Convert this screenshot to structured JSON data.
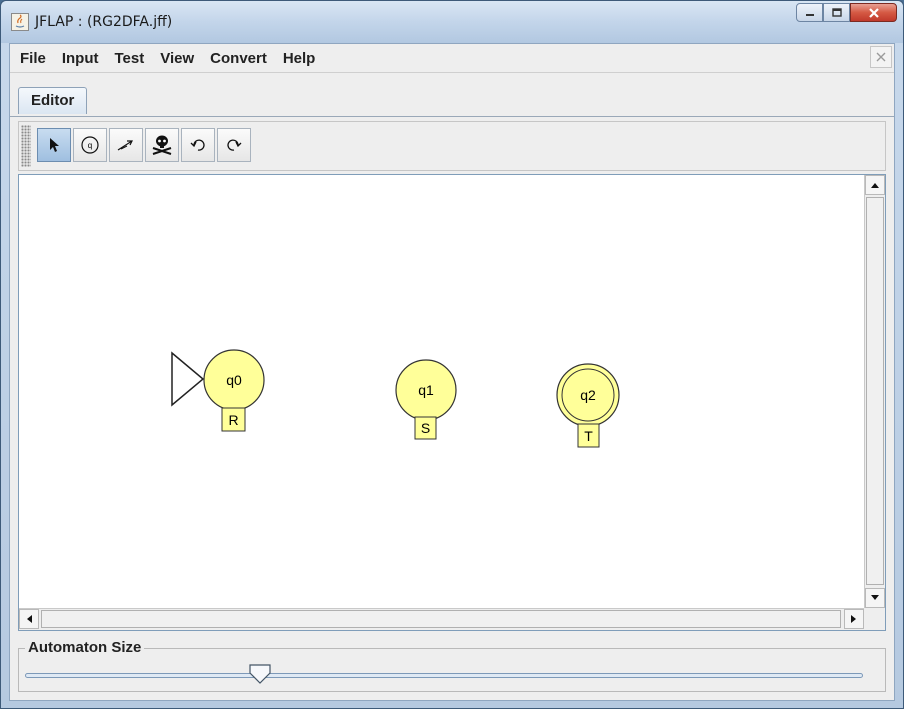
{
  "window": {
    "title": "JFLAP : (RG2DFA.jff)",
    "accent_close": "#c0392b"
  },
  "menu": [
    "File",
    "Input",
    "Test",
    "View",
    "Convert",
    "Help"
  ],
  "tabs": [
    {
      "label": "Editor",
      "active": true
    }
  ],
  "toolbar": {
    "tools": [
      {
        "name": "attribute-editor",
        "icon": "arrow-pointer-icon",
        "active": true
      },
      {
        "name": "state-creator",
        "icon": "state-circle-icon",
        "active": false
      },
      {
        "name": "transition-creator",
        "icon": "transition-arrow-icon",
        "active": false
      },
      {
        "name": "deleter",
        "icon": "skull-crossbones-icon",
        "active": false
      },
      {
        "name": "undo",
        "icon": "undo-icon",
        "active": false
      },
      {
        "name": "redo",
        "icon": "redo-icon",
        "active": false
      }
    ]
  },
  "automaton": {
    "state_fill": "#ffff99",
    "states": [
      {
        "name": "q0",
        "label": "R",
        "initial": true,
        "final": false
      },
      {
        "name": "q1",
        "label": "S",
        "initial": false,
        "final": false
      },
      {
        "name": "q2",
        "label": "T",
        "initial": false,
        "final": true
      }
    ]
  },
  "size_panel": {
    "title": "Automaton Size",
    "slider_value": 0.28
  }
}
